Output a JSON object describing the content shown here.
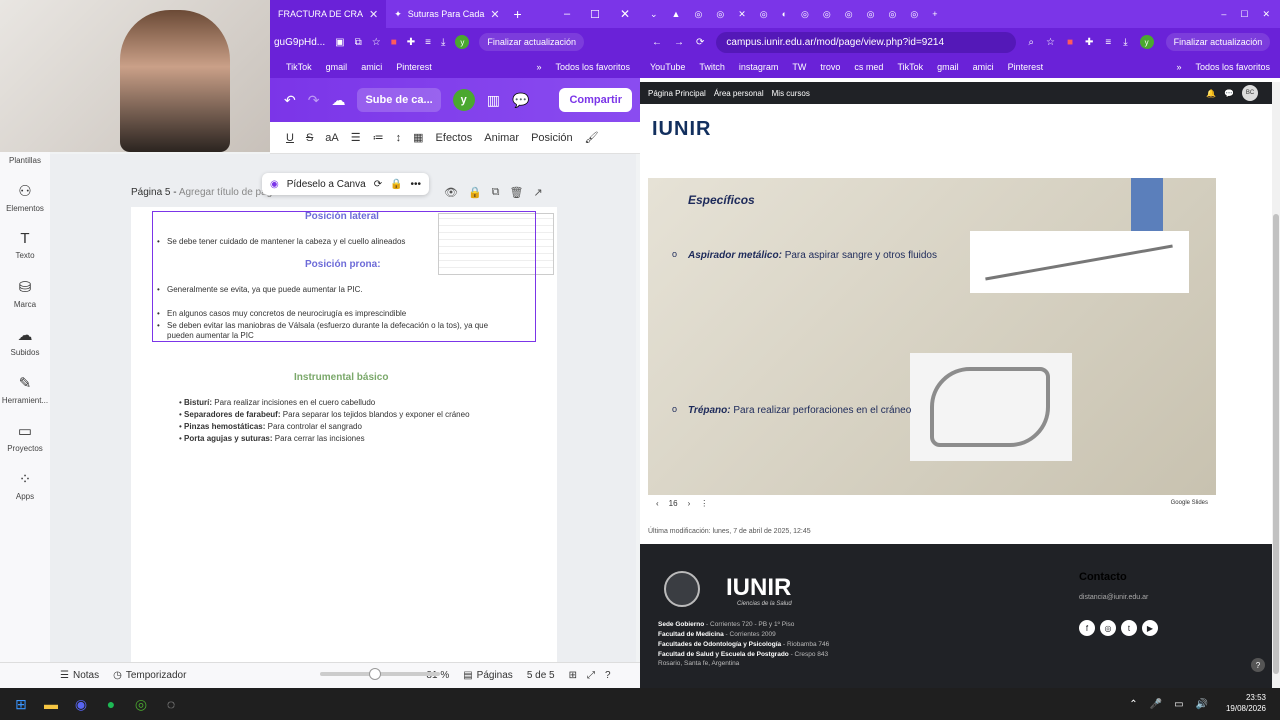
{
  "left_browser": {
    "tabs": [
      {
        "label": "FRACTURA DE CRA"
      },
      {
        "label": "Suturas Para Cada"
      }
    ],
    "url_fragment": "guG9pHd...",
    "finalizar_label": "Finalizar actualización",
    "bookmarks": [
      "TikTok",
      "gmail",
      "amici",
      "Pinterest"
    ],
    "favoritos_label": "Todos los favoritos",
    "avatar_letter": "y"
  },
  "canva": {
    "upload_label": "Sube de ca...",
    "share_label": "Compartir",
    "toolbar": {
      "effects": "Efectos",
      "animate": "Animar",
      "position": "Posición"
    },
    "sidebar": [
      {
        "label": "Plantillas"
      },
      {
        "label": "Elementos"
      },
      {
        "label": "Texto"
      },
      {
        "label": "Marca"
      },
      {
        "label": "Subidos"
      },
      {
        "label": "Herramient..."
      },
      {
        "label": "Proyectos"
      },
      {
        "label": "Apps"
      }
    ],
    "page_label": "Página 5 -",
    "page_title_placeholder": "Agregar título de página",
    "tip_label": "Pídeselo a Canva",
    "doc": {
      "pos_lateral": "Posición lateral",
      "bullet_lateral": "Se debe tener cuidado de mantener la cabeza y el cuello alineados",
      "pos_prona": "Posición prona:",
      "bullet_prona_1": "Generalmente se evita, ya que puede aumentar la PIC.",
      "bullet_prona_2": "En algunos casos muy concretos de neurocirugía es imprescindible",
      "bullet_prona_3a": "Se deben evitar las maniobras de Válsala (esfuerzo durante la defecación o la tos), ya que",
      "bullet_prona_3b": "pueden aumentar la PIC",
      "instr_title": "Instrumental básico",
      "instruments": [
        {
          "name": "Bisturí:",
          "desc": "Para realizar incisiones en el cuero cabelludo"
        },
        {
          "name": "Separadores de farabeuf:",
          "desc": "Para separar los tejidos blandos y exponer el cráneo"
        },
        {
          "name": "Pinzas hemostáticas:",
          "desc": "Para controlar el sangrado"
        },
        {
          "name": "Porta agujas y suturas:",
          "desc": "Para cerrar las incisiones"
        }
      ]
    },
    "bottom": {
      "notes": "Notas",
      "timer": "Temporizador",
      "zoom": "81 %",
      "pages": "Páginas",
      "page_count": "5 de 5"
    }
  },
  "right_browser": {
    "url": "campus.iunir.edu.ar/mod/page/view.php?id=9214",
    "finalizar_label": "Finalizar actualización",
    "avatar_letter": "y",
    "bookmarks": [
      "YouTube",
      "Twitch",
      "instagram",
      "TW",
      "trovo",
      "cs med",
      "TikTok",
      "gmail",
      "amici",
      "Pinterest"
    ],
    "favoritos_label": "Todos los favoritos",
    "site_nav": [
      "Página Principal",
      "Área personal",
      "Mis cursos"
    ],
    "user_initials": "BC",
    "logo": "IUNIR"
  },
  "slide": {
    "heading": "Específicos",
    "item1_bold": "Aspirador metálico:",
    "item1_text": " Para aspirar sangre y otros fluidos",
    "item2_bold": "Trépano:",
    "item2_text": " Para realizar perforaciones en el cráneo",
    "slide_number": "16",
    "google_slides": "Google Slides"
  },
  "page_info": {
    "last_modified": "Última modificación: lunes, 7 de abril de 2025, 12:45"
  },
  "footer": {
    "logo": "IUNIR",
    "subtitle": "Ciencias de la Salud",
    "lines": [
      {
        "bold": "Sede Gobierno",
        "text": " - Corrientes 720 - PB y 1º Piso"
      },
      {
        "bold": "Facultad de Medicina",
        "text": " - Corrientes 2009"
      },
      {
        "bold": "Facultades de Odontología y Psicología",
        "text": " - Riobamba 746"
      },
      {
        "bold": "Facultad de Salud y Escuela de Postgrado",
        "text": " - Crespo 843"
      },
      {
        "bold": "",
        "text": "Rosario, Santa fe, Argentina"
      }
    ],
    "contact_title": "Contacto",
    "email": "distancia@iunir.edu.ar"
  },
  "taskbar": {
    "time": "23:53",
    "date": "19/08/2026"
  }
}
